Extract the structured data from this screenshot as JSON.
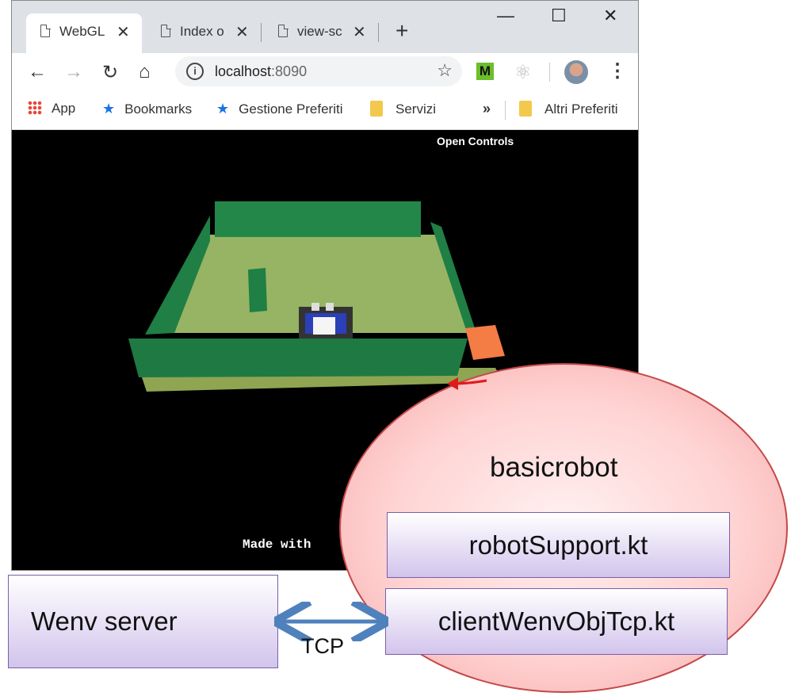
{
  "browser": {
    "tabs": [
      {
        "title": "WebGL"
      },
      {
        "title": "Index o"
      },
      {
        "title": "view-sc"
      }
    ],
    "close_glyph": "✕",
    "new_tab_glyph": "+",
    "window_controls": {
      "minimize": "—",
      "maximize": "☐",
      "close": "✕"
    },
    "address": {
      "host": "localhost",
      "port": ":8090"
    },
    "extension_label": "M",
    "bookmarks": [
      {
        "label": "App",
        "icon": "apps-grid-icon"
      },
      {
        "label": "Bookmarks",
        "icon": "star-icon"
      },
      {
        "label": "Gestione Preferiti",
        "icon": "star-icon"
      },
      {
        "label": "Servizi",
        "icon": "folder-icon"
      }
    ],
    "bookmarks_overflow": "»",
    "other_bookmarks": "Altri Preferiti"
  },
  "webgl": {
    "open_controls": "Open Controls",
    "footer": "Made with"
  },
  "diagram": {
    "component": "basicrobot",
    "robot_support": "robotSupport.kt",
    "client": "clientWenvObjTcp.kt",
    "server": "Wenv server",
    "link_label": "TCP"
  },
  "colors": {
    "wall": "#1f7f45",
    "floor": "#96b463",
    "obstacle_box": "#f47c45",
    "ellipse_border": "#c44848",
    "arrow_blue": "#4f81bd",
    "arrow_red": "#e01a1a"
  }
}
